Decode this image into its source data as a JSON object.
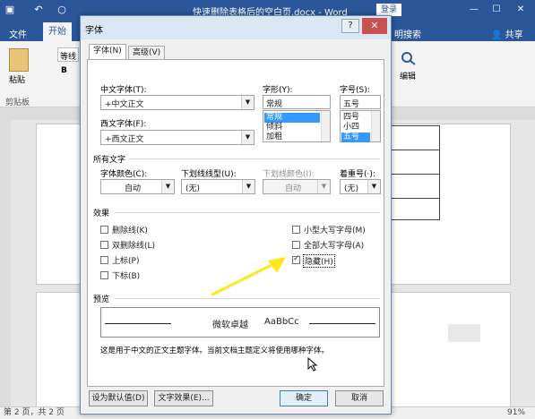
{
  "word": {
    "doc_title": "快速删除表格后的空白页.docx - Word",
    "login_label": "登录",
    "minimize": "—",
    "maximize": "☐",
    "close": "✕",
    "menu": {
      "file": "文件",
      "home": "开始",
      "tell_me": "明搜索",
      "share": "共享"
    },
    "ribbon": {
      "paste": "粘贴",
      "clipboard": "剪贴板",
      "font_name": "等线",
      "edit": "编辑"
    },
    "status": {
      "page": "第 2 页，共 2 页",
      "zoom": "91%"
    }
  },
  "dialog": {
    "title": "字体",
    "help": "?",
    "close": "✕",
    "tabs": [
      "字体(N)",
      "高级(V)"
    ],
    "asian_font": {
      "label": "中文字体(T):",
      "value": "+中文正文"
    },
    "western_font": {
      "label": "西文字体(F):",
      "value": "+西文正文"
    },
    "style": {
      "label": "字形(Y):",
      "value": "常规",
      "options": [
        "常规",
        "倾斜",
        "加粗"
      ],
      "selected": 0
    },
    "size": {
      "label": "字号(S):",
      "value": "五号",
      "options": [
        "四号",
        "小四",
        "五号"
      ],
      "selected": 2
    },
    "all_text": {
      "heading": "所有文字",
      "font_color_label": "字体颜色(C):",
      "font_color_value": "自动",
      "underline_style_label": "下划线线型(U):",
      "underline_style_value": "(无)",
      "underline_color_label": "下划线颜色(I):",
      "underline_color_value": "自动",
      "emphasis_label": "着重号(·):",
      "emphasis_value": "(无)"
    },
    "effects": {
      "heading": "效果",
      "strikethrough": "删除线(K)",
      "double_strikethrough": "双删除线(L)",
      "superscript": "上标(P)",
      "subscript": "下标(B)",
      "small_caps": "小型大写字母(M)",
      "all_caps": "全部大写字母(A)",
      "hidden": "隐藏(H)",
      "hidden_checked": true
    },
    "preview": {
      "heading": "预览",
      "sample_cn": "微软卓越",
      "sample_en": "AaBbCc",
      "description": "这是用于中文的正文主题字体。当前文档主题定义将使用哪种字体。"
    },
    "buttons": {
      "set_default": "设为默认值(D)",
      "text_effects": "文字效果(E)...",
      "ok": "确定",
      "cancel": "取消"
    }
  },
  "colors": {
    "word_blue": "#2b579a",
    "arrow_yellow": "#ffe81a",
    "selection": "#3399ff"
  }
}
